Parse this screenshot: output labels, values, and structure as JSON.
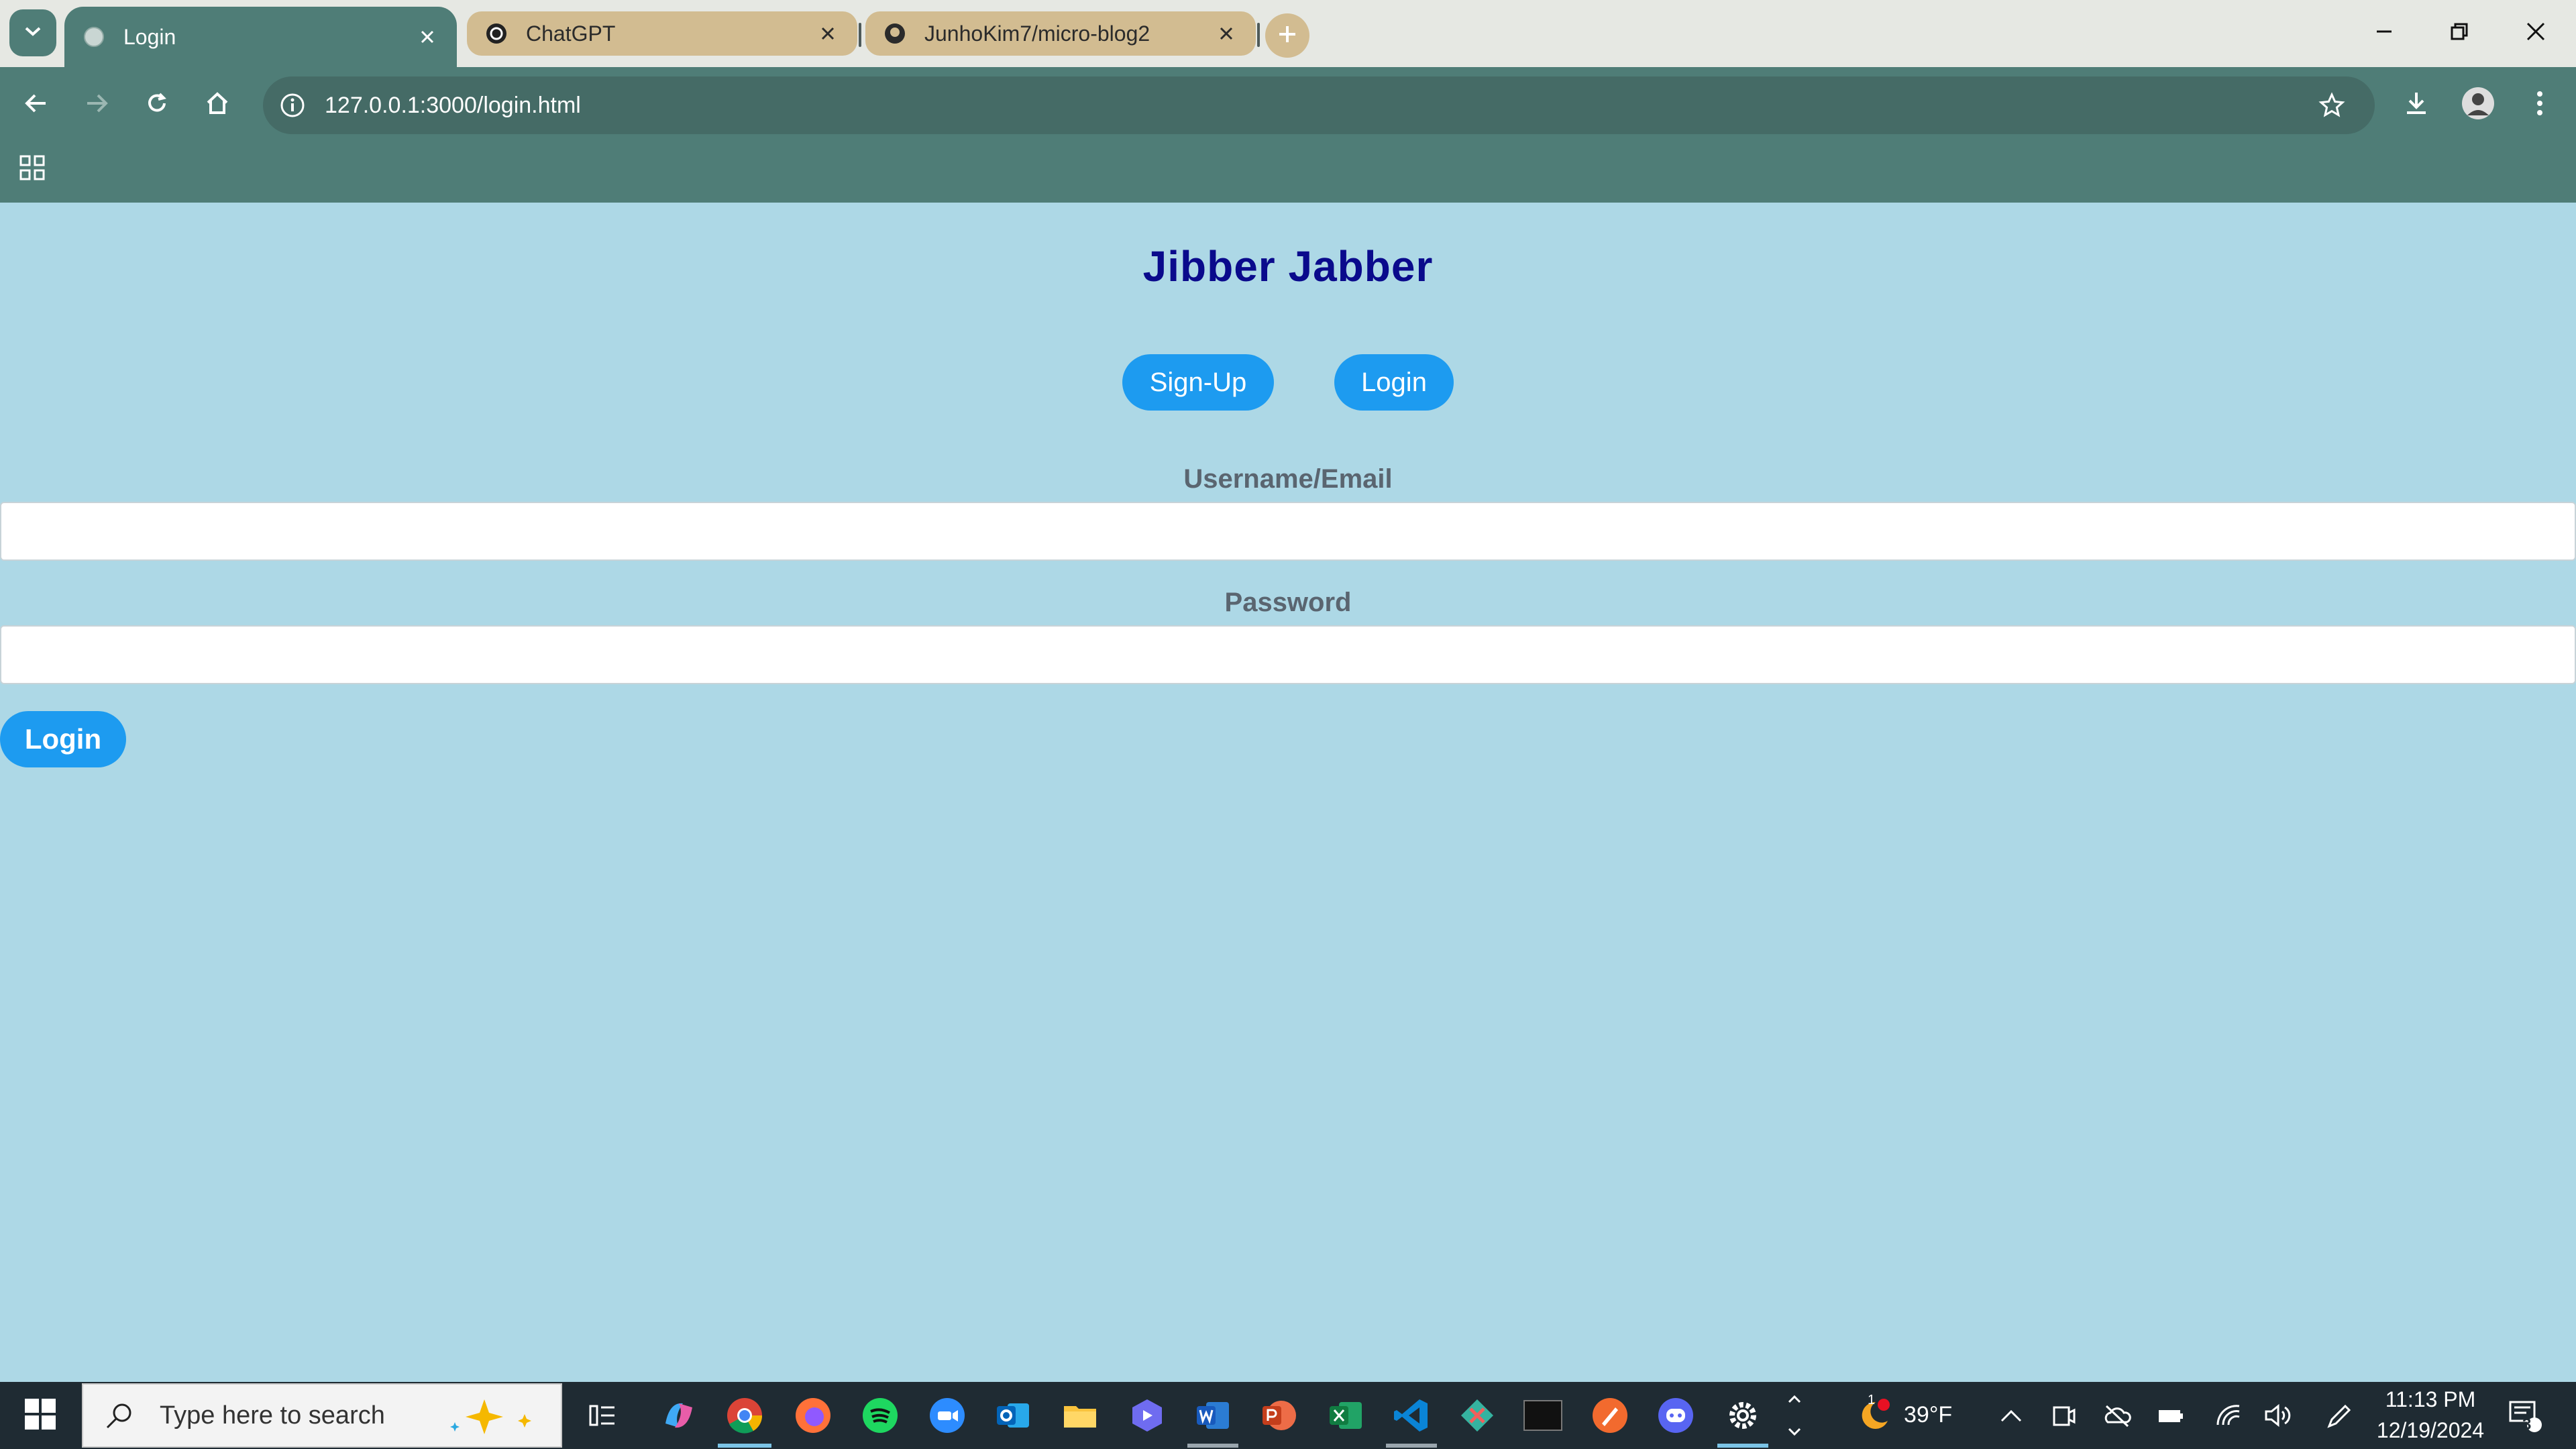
{
  "browser": {
    "tabs": [
      {
        "title": "Login",
        "active": true,
        "icon": "globe-icon"
      },
      {
        "title": "ChatGPT",
        "active": false,
        "icon": "openai-icon"
      },
      {
        "title": "JunhoKim7/micro-blog2",
        "active": false,
        "icon": "github-icon"
      }
    ],
    "url": "127.0.0.1:3000/login.html"
  },
  "page": {
    "title": "Jibber Jabber",
    "nav": {
      "signup_label": "Sign-Up",
      "login_label": "Login"
    },
    "form": {
      "username_label": "Username/Email",
      "password_label": "Password",
      "submit_label": "Login"
    }
  },
  "taskbar": {
    "search_placeholder": "Type here to search",
    "weather": "39°F",
    "weather_badge": "1",
    "time": "11:13 PM",
    "date": "12/19/2024",
    "notifications": "3"
  },
  "colors": {
    "chrome": "#4f7d77",
    "page_bg": "#add8e6",
    "title": "#0a0a8c",
    "button": "#1d9bf0"
  }
}
